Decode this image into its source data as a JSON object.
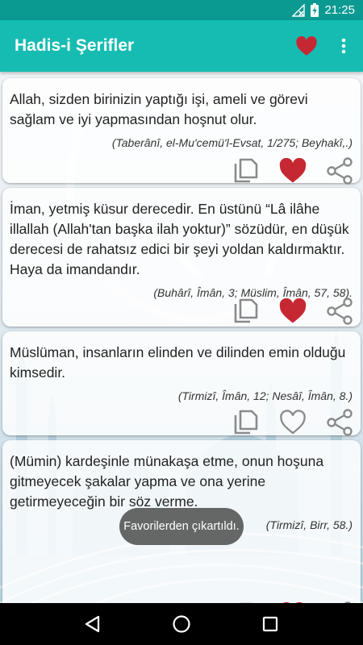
{
  "status_bar": {
    "time": "21:25"
  },
  "app_bar": {
    "title": "Hadis-i Şerifler"
  },
  "cards": [
    {
      "text": "Allah, sizden birinizin yaptığı işi, ameli ve görevi sağlam ve iyi yapmasından hoşnut olur.",
      "source": "(Taberânî, el-Mu'cemü'l-Evsat, 1/275; Beyhakî,.)",
      "favorite": true
    },
    {
      "text": "İman, yetmiş küsur derecedir. En üstünü “Lâ ilâhe illallah (Allah'tan başka ilah yoktur)” sözüdür, en düşük derecesi de rahatsız edici bir şeyi yoldan kaldırmaktır. Haya da imandandır.",
      "source": "(Buhârî, Îmân, 3; Müslim, Îmân, 57, 58).",
      "favorite": true
    },
    {
      "text": "Müslüman, insanların elinden ve dilinden emin olduğu kimsedir.",
      "source": "(Tirmizî, Îmân, 12; Nesâî, Îmân, 8.)",
      "favorite": false
    },
    {
      "text": "(Mümin) kardeşinle münakaşa etme, onun hoşuna gitmeyecek şakalar yapma ve ona yerine getirmeyeceğin bir söz verme.",
      "source": "(Tirmizî, Birr, 58.)",
      "favorite": true
    }
  ],
  "toast": {
    "message": "Favorilerden çıkartıldı."
  },
  "colors": {
    "status_bar": "#0b9a91",
    "app_bar": "#16bcb2",
    "heart": "#c62833",
    "icon_gray": "#8a8a8a"
  }
}
